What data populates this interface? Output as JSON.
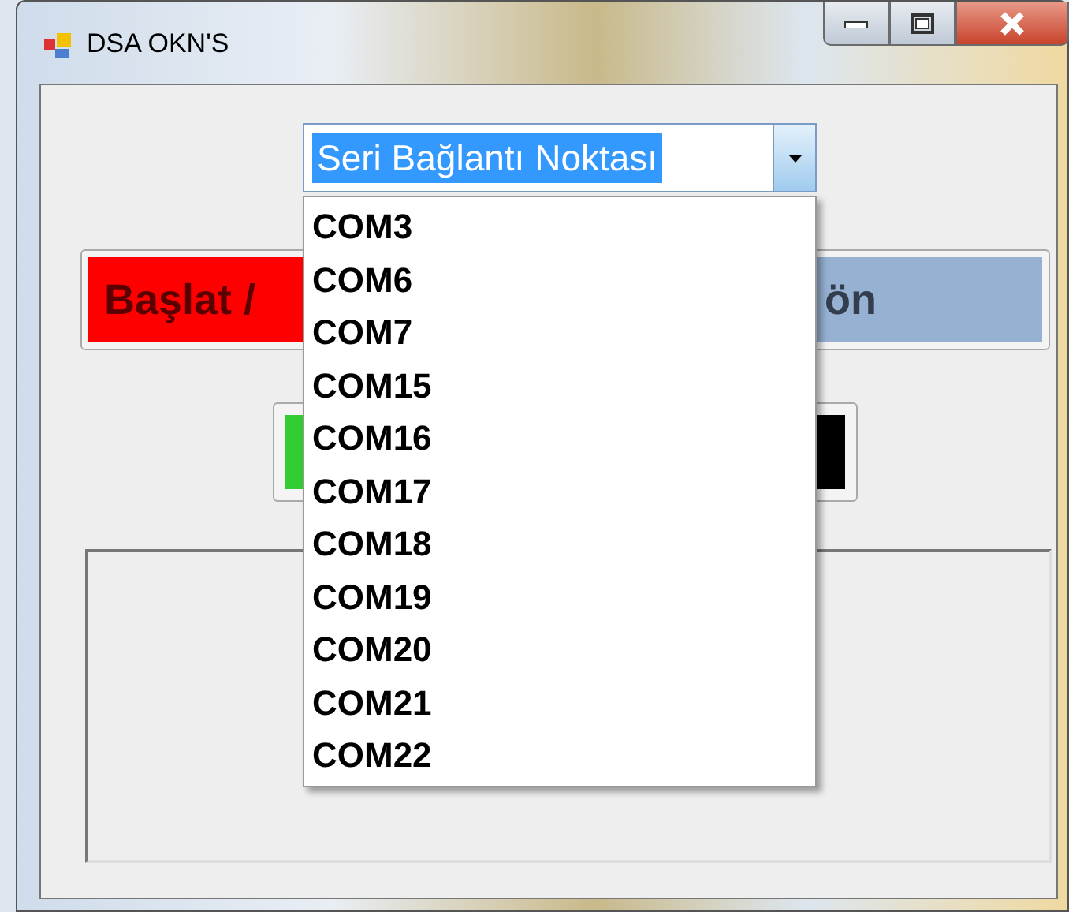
{
  "window": {
    "title": "DSA OKN'S"
  },
  "port_select": {
    "value": "Seri Bağlantı Noktası",
    "text_selected": true,
    "expanded": true,
    "options": [
      {
        "label": "COM3"
      },
      {
        "label": "COM6"
      },
      {
        "label": "COM7"
      },
      {
        "label": "COM15"
      },
      {
        "label": "COM16"
      },
      {
        "label": "COM17"
      },
      {
        "label": "COM18"
      },
      {
        "label": "COM19"
      },
      {
        "label": "COM20"
      },
      {
        "label": "COM21"
      },
      {
        "label": "COM22"
      }
    ]
  },
  "buttons": [
    {
      "label": "Başlat /",
      "color": "#ff0000"
    },
    {
      "label": "ön",
      "color": "#96b1d2"
    }
  ],
  "indicators": [
    {
      "color": "#33cc33"
    },
    {
      "color": "#000000"
    }
  ]
}
